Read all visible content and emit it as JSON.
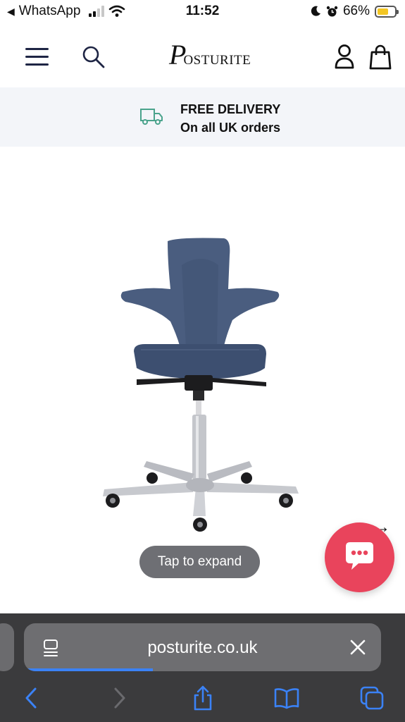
{
  "status_bar": {
    "back_app": "WhatsApp",
    "time": "11:52",
    "battery_percent": "66%",
    "battery_level": 0.66,
    "icons": [
      "back-arrow-icon",
      "cellular-signal-icon",
      "wifi-icon",
      "moon-icon",
      "alarm-icon",
      "battery-icon"
    ]
  },
  "header": {
    "logo_initial": "P",
    "logo_rest": "OSTURITE",
    "icons": [
      "menu-icon",
      "search-icon",
      "account-icon",
      "bag-icon"
    ]
  },
  "delivery_banner": {
    "line1": "FREE DELIVERY",
    "line2": "On all UK orders",
    "icon": "truck-icon",
    "icon_color": "#4aa38c"
  },
  "product": {
    "tap_to_expand": "Tap to expand",
    "prev_arrow": "←",
    "next_arrow": "→",
    "chat_color": "#e9445c"
  },
  "browser": {
    "url": "posturite.co.uk",
    "load_progress": 0.36,
    "accent_color": "#3b82f6",
    "toolbar": [
      "back-icon",
      "forward-icon",
      "share-icon",
      "bookmarks-icon",
      "tabs-icon"
    ]
  }
}
